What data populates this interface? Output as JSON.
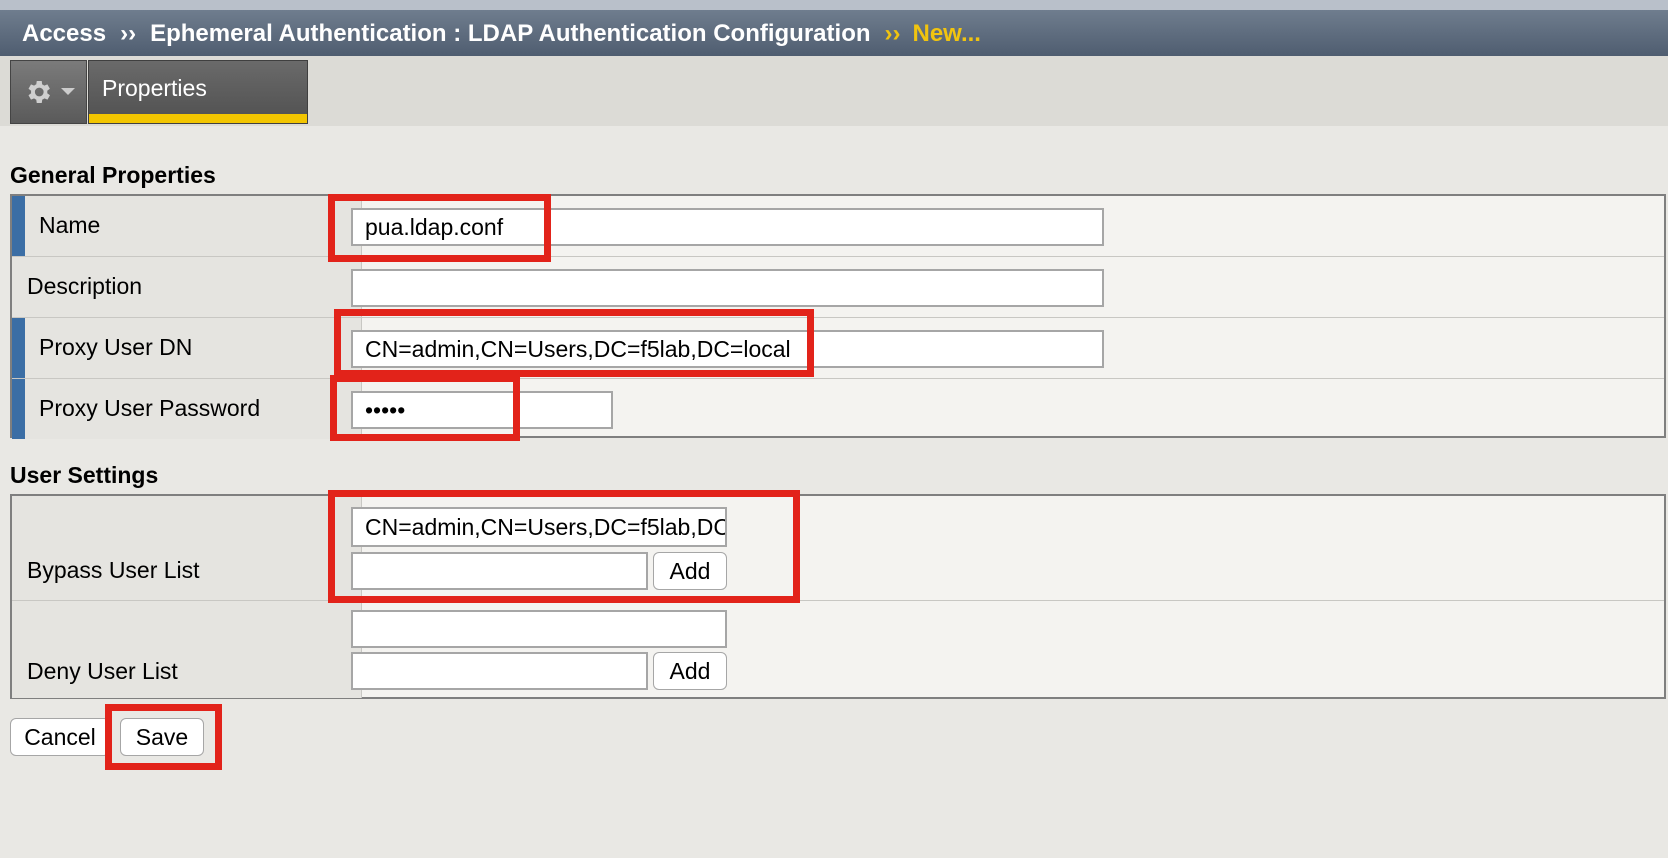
{
  "breadcrumb": {
    "root": "Access",
    "separator": "››",
    "section": "Ephemeral Authentication : LDAP Authentication Configuration",
    "current": "New..."
  },
  "toolbar": {
    "gear_icon": "gear-icon",
    "tab_label": "Properties"
  },
  "general_properties": {
    "title": "General Properties",
    "name_label": "Name",
    "name_value": "pua.ldap.conf",
    "description_label": "Description",
    "description_value": "",
    "proxy_user_dn_label": "Proxy User DN",
    "proxy_user_dn_value": "CN=admin,CN=Users,DC=f5lab,DC=local",
    "proxy_user_password_label": "Proxy User Password",
    "proxy_user_password_value": "•••••"
  },
  "user_settings": {
    "title": "User Settings",
    "bypass_label": "Bypass User List",
    "bypass_entry": "CN=admin,CN=Users,DC=f5lab,DC=",
    "bypass_input_value": "",
    "bypass_add_label": "Add",
    "deny_label": "Deny User List",
    "deny_entry": "",
    "deny_input_value": "",
    "deny_add_label": "Add"
  },
  "actions": {
    "cancel_label": "Cancel",
    "save_label": "Save"
  },
  "colors": {
    "highlight": "#e2231a",
    "required_marker": "#3b6ea5",
    "tab_accent": "#f2c500"
  }
}
